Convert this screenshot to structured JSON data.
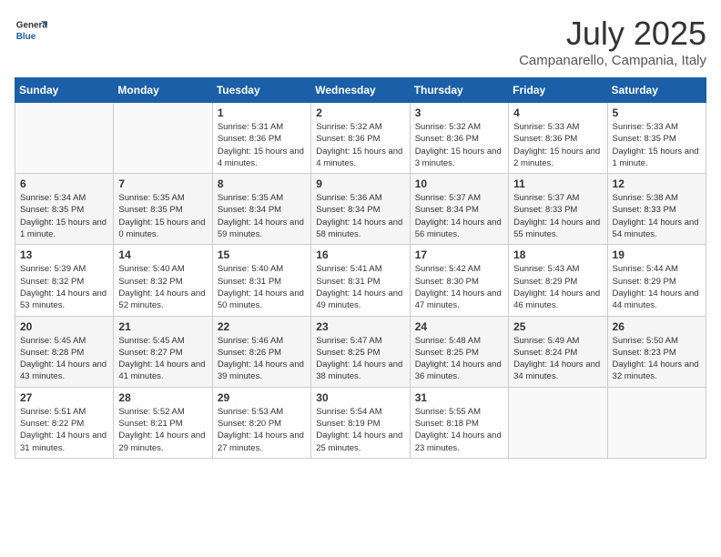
{
  "header": {
    "logo_general": "General",
    "logo_blue": "Blue",
    "month_year": "July 2025",
    "location": "Campanarello, Campania, Italy"
  },
  "days_of_week": [
    "Sunday",
    "Monday",
    "Tuesday",
    "Wednesday",
    "Thursday",
    "Friday",
    "Saturday"
  ],
  "weeks": [
    [
      {
        "day": "",
        "info": ""
      },
      {
        "day": "",
        "info": ""
      },
      {
        "day": "1",
        "info": "Sunrise: 5:31 AM\nSunset: 8:36 PM\nDaylight: 15 hours and 4 minutes."
      },
      {
        "day": "2",
        "info": "Sunrise: 5:32 AM\nSunset: 8:36 PM\nDaylight: 15 hours and 4 minutes."
      },
      {
        "day": "3",
        "info": "Sunrise: 5:32 AM\nSunset: 8:36 PM\nDaylight: 15 hours and 3 minutes."
      },
      {
        "day": "4",
        "info": "Sunrise: 5:33 AM\nSunset: 8:36 PM\nDaylight: 15 hours and 2 minutes."
      },
      {
        "day": "5",
        "info": "Sunrise: 5:33 AM\nSunset: 8:35 PM\nDaylight: 15 hours and 1 minute."
      }
    ],
    [
      {
        "day": "6",
        "info": "Sunrise: 5:34 AM\nSunset: 8:35 PM\nDaylight: 15 hours and 1 minute."
      },
      {
        "day": "7",
        "info": "Sunrise: 5:35 AM\nSunset: 8:35 PM\nDaylight: 15 hours and 0 minutes."
      },
      {
        "day": "8",
        "info": "Sunrise: 5:35 AM\nSunset: 8:34 PM\nDaylight: 14 hours and 59 minutes."
      },
      {
        "day": "9",
        "info": "Sunrise: 5:36 AM\nSunset: 8:34 PM\nDaylight: 14 hours and 58 minutes."
      },
      {
        "day": "10",
        "info": "Sunrise: 5:37 AM\nSunset: 8:34 PM\nDaylight: 14 hours and 56 minutes."
      },
      {
        "day": "11",
        "info": "Sunrise: 5:37 AM\nSunset: 8:33 PM\nDaylight: 14 hours and 55 minutes."
      },
      {
        "day": "12",
        "info": "Sunrise: 5:38 AM\nSunset: 8:33 PM\nDaylight: 14 hours and 54 minutes."
      }
    ],
    [
      {
        "day": "13",
        "info": "Sunrise: 5:39 AM\nSunset: 8:32 PM\nDaylight: 14 hours and 53 minutes."
      },
      {
        "day": "14",
        "info": "Sunrise: 5:40 AM\nSunset: 8:32 PM\nDaylight: 14 hours and 52 minutes."
      },
      {
        "day": "15",
        "info": "Sunrise: 5:40 AM\nSunset: 8:31 PM\nDaylight: 14 hours and 50 minutes."
      },
      {
        "day": "16",
        "info": "Sunrise: 5:41 AM\nSunset: 8:31 PM\nDaylight: 14 hours and 49 minutes."
      },
      {
        "day": "17",
        "info": "Sunrise: 5:42 AM\nSunset: 8:30 PM\nDaylight: 14 hours and 47 minutes."
      },
      {
        "day": "18",
        "info": "Sunrise: 5:43 AM\nSunset: 8:29 PM\nDaylight: 14 hours and 46 minutes."
      },
      {
        "day": "19",
        "info": "Sunrise: 5:44 AM\nSunset: 8:29 PM\nDaylight: 14 hours and 44 minutes."
      }
    ],
    [
      {
        "day": "20",
        "info": "Sunrise: 5:45 AM\nSunset: 8:28 PM\nDaylight: 14 hours and 43 minutes."
      },
      {
        "day": "21",
        "info": "Sunrise: 5:45 AM\nSunset: 8:27 PM\nDaylight: 14 hours and 41 minutes."
      },
      {
        "day": "22",
        "info": "Sunrise: 5:46 AM\nSunset: 8:26 PM\nDaylight: 14 hours and 39 minutes."
      },
      {
        "day": "23",
        "info": "Sunrise: 5:47 AM\nSunset: 8:25 PM\nDaylight: 14 hours and 38 minutes."
      },
      {
        "day": "24",
        "info": "Sunrise: 5:48 AM\nSunset: 8:25 PM\nDaylight: 14 hours and 36 minutes."
      },
      {
        "day": "25",
        "info": "Sunrise: 5:49 AM\nSunset: 8:24 PM\nDaylight: 14 hours and 34 minutes."
      },
      {
        "day": "26",
        "info": "Sunrise: 5:50 AM\nSunset: 8:23 PM\nDaylight: 14 hours and 32 minutes."
      }
    ],
    [
      {
        "day": "27",
        "info": "Sunrise: 5:51 AM\nSunset: 8:22 PM\nDaylight: 14 hours and 31 minutes."
      },
      {
        "day": "28",
        "info": "Sunrise: 5:52 AM\nSunset: 8:21 PM\nDaylight: 14 hours and 29 minutes."
      },
      {
        "day": "29",
        "info": "Sunrise: 5:53 AM\nSunset: 8:20 PM\nDaylight: 14 hours and 27 minutes."
      },
      {
        "day": "30",
        "info": "Sunrise: 5:54 AM\nSunset: 8:19 PM\nDaylight: 14 hours and 25 minutes."
      },
      {
        "day": "31",
        "info": "Sunrise: 5:55 AM\nSunset: 8:18 PM\nDaylight: 14 hours and 23 minutes."
      },
      {
        "day": "",
        "info": ""
      },
      {
        "day": "",
        "info": ""
      }
    ]
  ]
}
